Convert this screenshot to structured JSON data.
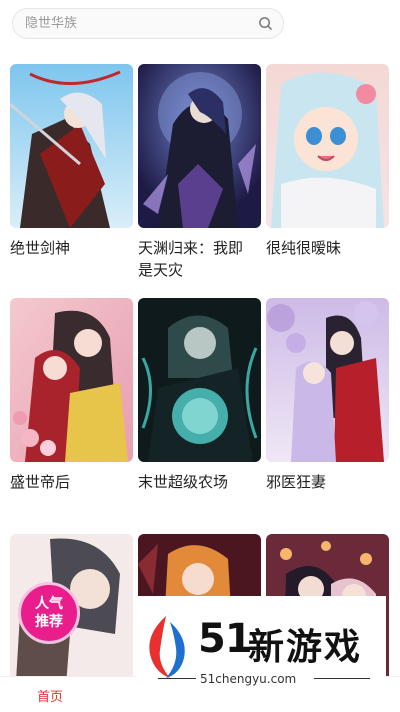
{
  "search": {
    "placeholder": "隐世华族"
  },
  "comics": [
    {
      "title": "绝世剑神"
    },
    {
      "title": "天渊归来：我即\n是天灾"
    },
    {
      "title": "很纯很暧昧"
    },
    {
      "title": "盛世帝后"
    },
    {
      "title": "末世超级农场"
    },
    {
      "title": "邪医狂妻"
    },
    {
      "title": ""
    },
    {
      "title": ""
    },
    {
      "title": ""
    }
  ],
  "badge": {
    "line1": "人气",
    "line2": "推荐"
  },
  "tabbar": {
    "home": "首页"
  },
  "watermark": {
    "num": "51",
    "name": "新游戏",
    "url": "51chengyu.com"
  },
  "colors": {
    "accent": "#e8312f",
    "badge": "#e91e8c"
  }
}
